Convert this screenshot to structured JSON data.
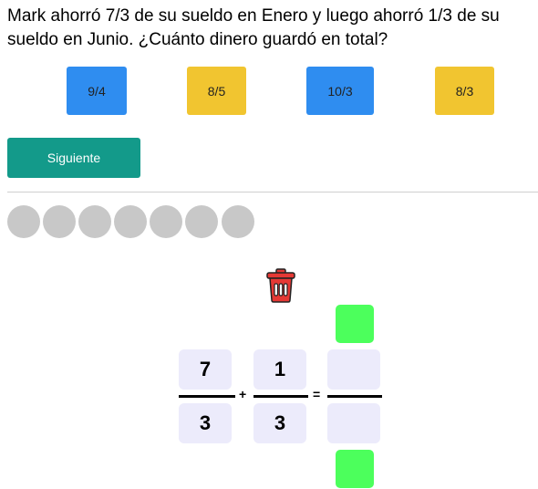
{
  "question": "Mark ahorró 7/3 de su sueldo en Enero y luego ahorró 1/3 de su sueldo en Junio. ¿Cuánto dinero guardó en total?",
  "answers": [
    {
      "label": "9/4",
      "color": "#2f8df0"
    },
    {
      "label": "8/5",
      "color": "#f1c530"
    },
    {
      "label": "10/3",
      "color": "#2f8df0"
    },
    {
      "label": "8/3",
      "color": "#f1c530"
    }
  ],
  "next_button": "Siguiente",
  "progress": {
    "total": 7,
    "completed": 0
  },
  "trash_icon": "trash-can-icon",
  "equation": {
    "fraction1": {
      "numerator": "7",
      "denominator": "3"
    },
    "operator": "+",
    "fraction2": {
      "numerator": "1",
      "denominator": "3"
    },
    "equals": "=",
    "result": {
      "numerator": "",
      "denominator": ""
    }
  },
  "colors": {
    "accent_green": "#4cff5c",
    "button_teal": "#139a8a",
    "cell_bg": "#ecebfb",
    "trash_red": "#e53935"
  }
}
